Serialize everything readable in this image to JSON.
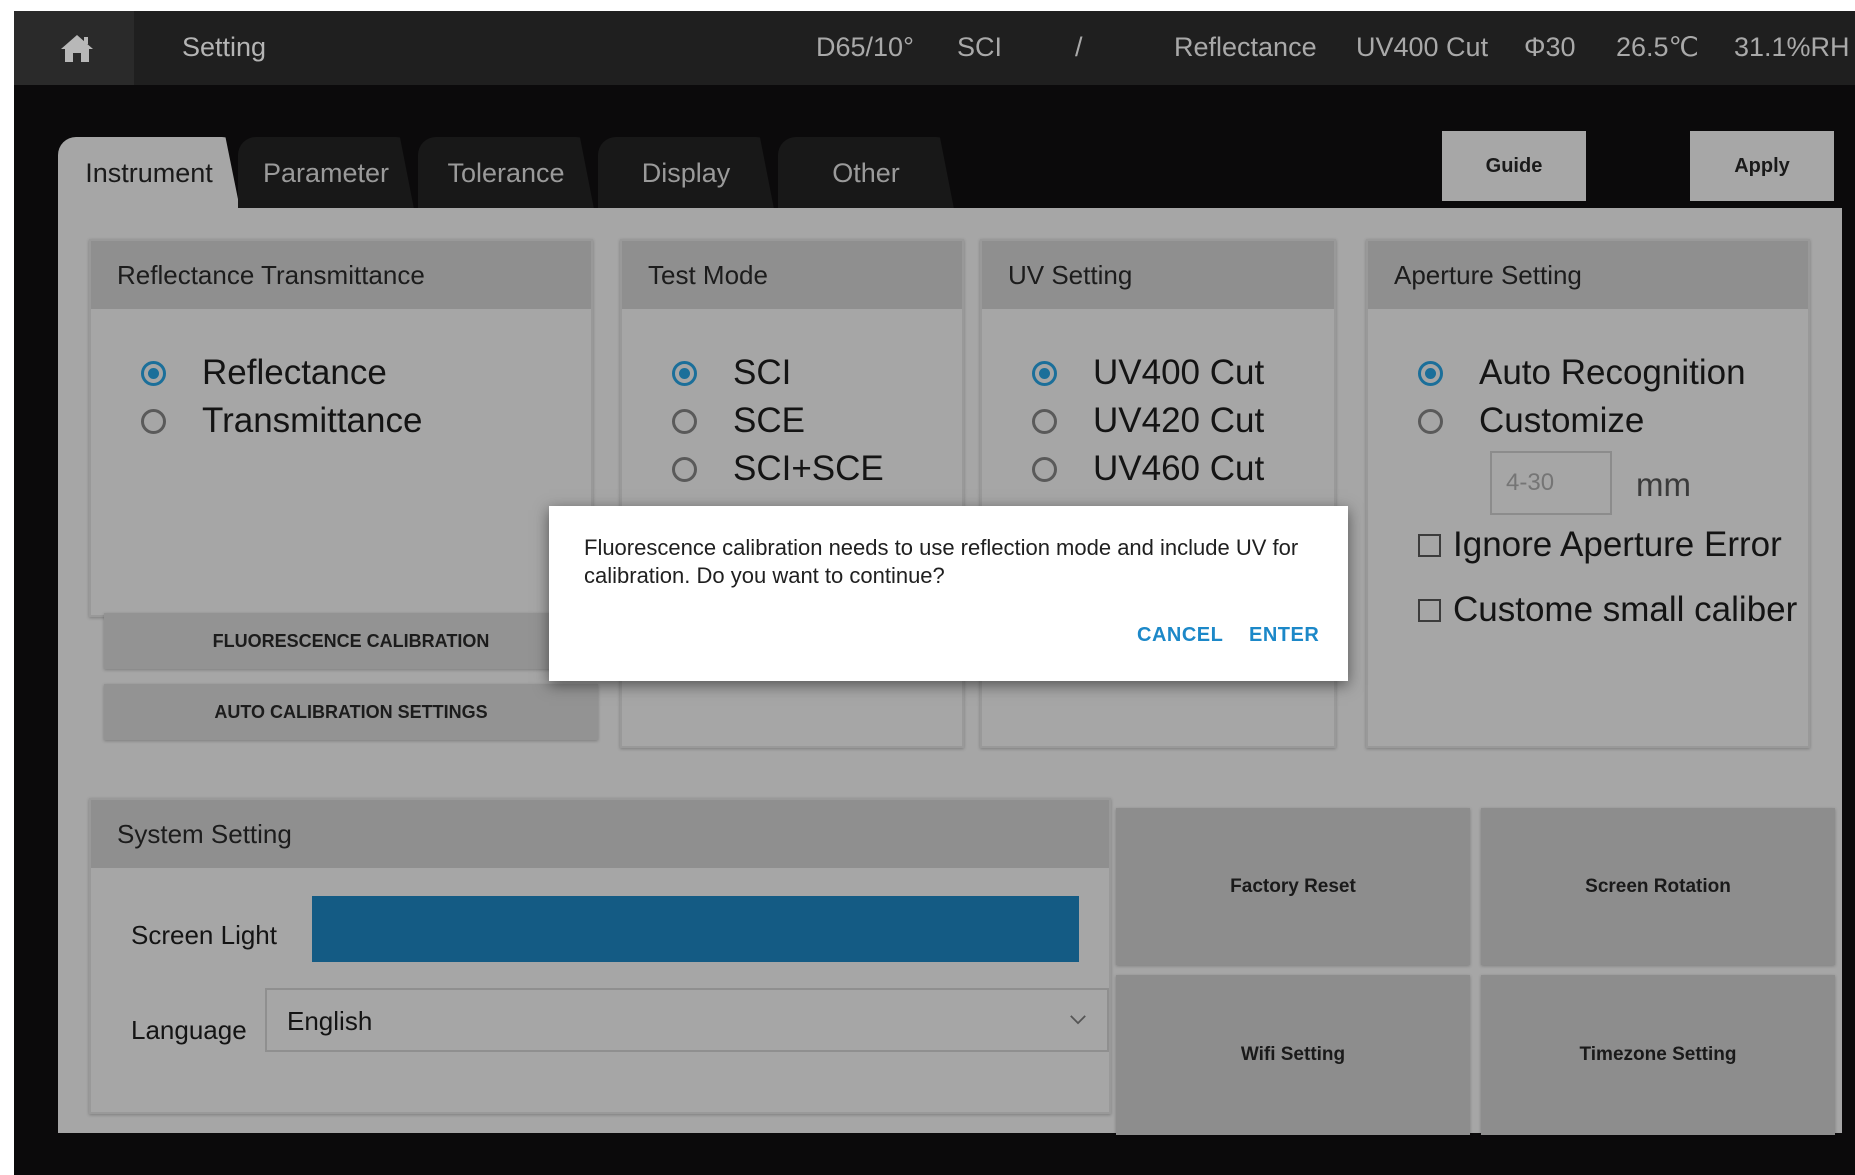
{
  "topbar": {
    "title": "Setting",
    "illuminant": "D65/10°",
    "mode": "SCI",
    "separator": "/",
    "measure": "Reflectance",
    "uv": "UV400 Cut",
    "aperture": "Φ30",
    "temperature": "26.5℃",
    "humidity": "31.1%RH",
    "home_icon": "home-icon"
  },
  "tabs": [
    {
      "label": "Instrument",
      "active": true
    },
    {
      "label": "Parameter",
      "active": false
    },
    {
      "label": "Tolerance",
      "active": false
    },
    {
      "label": "Display",
      "active": false
    },
    {
      "label": "Other",
      "active": false
    }
  ],
  "buttons": {
    "guide": "Guide",
    "apply": "Apply"
  },
  "reflectance_group": {
    "title": "Reflectance Transmittance",
    "options": [
      "Reflectance",
      "Transmittance"
    ],
    "selected": "Reflectance"
  },
  "test_mode_group": {
    "title": "Test Mode",
    "options": [
      "SCI",
      "SCE",
      "SCI+SCE"
    ],
    "selected": "SCI"
  },
  "uv_group": {
    "title": "UV Setting",
    "options": [
      "UV400 Cut",
      "UV420 Cut",
      "UV460 Cut"
    ],
    "selected": "UV400 Cut"
  },
  "aperture_group": {
    "title": "Aperture Setting",
    "options": [
      "Auto Recognition",
      "Customize"
    ],
    "selected": "Auto Recognition",
    "custom_placeholder": "4-30",
    "unit": "mm",
    "checkboxes": [
      "Ignore Aperture Error",
      "Custome small caliber"
    ]
  },
  "calibration": {
    "fluorescence": "FLUORESCENCE CALIBRATION",
    "auto": "AUTO CALIBRATION SETTINGS"
  },
  "system": {
    "title": "System Setting",
    "screen_light_label": "Screen Light",
    "screen_light_level": 1.0,
    "language_label": "Language",
    "language_value": "English"
  },
  "system_buttons": {
    "factory_reset": "Factory Reset",
    "screen_rotation": "Screen Rotation",
    "wifi": "Wifi Setting",
    "timezone": "Timezone Setting"
  },
  "dialog": {
    "message": "Fluorescence calibration needs to use reflection mode and include UV for calibration. Do you want to continue?",
    "cancel": "CANCEL",
    "enter": "ENTER"
  },
  "colors": {
    "accent": "#1b6f9a",
    "slider": "#145b84",
    "dialog_button": "#1c88c8"
  }
}
